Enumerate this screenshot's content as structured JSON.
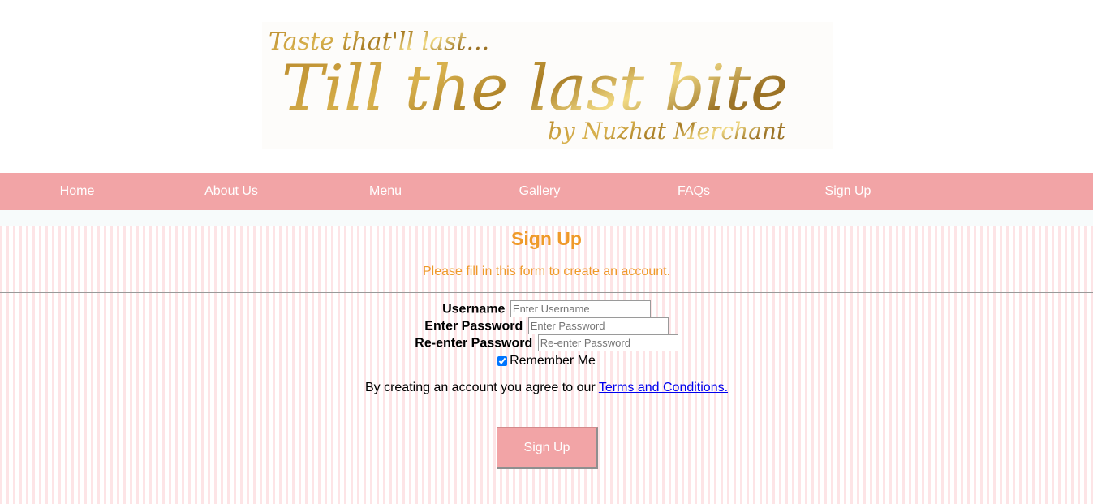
{
  "logo": {
    "tagline": "Taste that'll last...",
    "name": "Till the last bite",
    "byline": "by Nuzhat Merchant"
  },
  "nav": {
    "items": [
      {
        "label": "Home"
      },
      {
        "label": "About Us"
      },
      {
        "label": "Menu"
      },
      {
        "label": "Gallery"
      },
      {
        "label": "FAQs"
      },
      {
        "label": "Sign Up"
      }
    ]
  },
  "form": {
    "title": "Sign Up",
    "subtitle": "Please fill in this form to create an account.",
    "username_label": "Username",
    "username_placeholder": "Enter Username",
    "password_label": "Enter Password",
    "password_placeholder": "Enter Password",
    "repassword_label": "Re-enter Password",
    "repassword_placeholder": "Re-enter Password",
    "remember_label": "Remember Me",
    "remember_checked": true,
    "terms_text": "By creating an account you agree to our ",
    "terms_link": "Terms and Conditions.",
    "submit_label": "Sign Up"
  },
  "colors": {
    "nav_bg": "#f2a4a6",
    "accent_orange": "#ef9a2a",
    "stripe_pink": "#fde4e6",
    "logo_gold": "#c9a23a"
  }
}
